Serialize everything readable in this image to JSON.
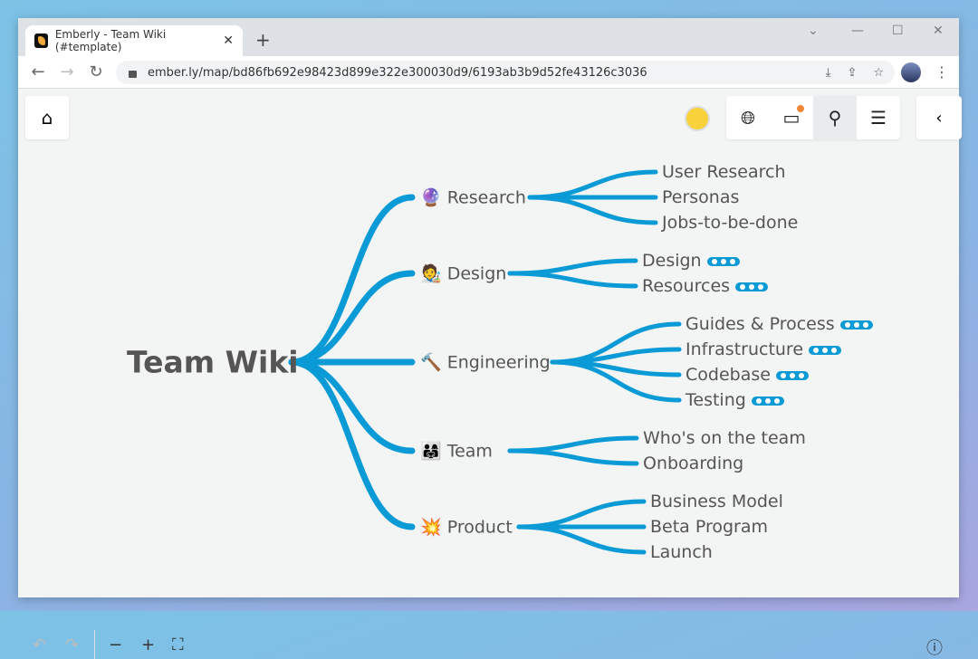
{
  "browser": {
    "tab_title": "Emberly - Team Wiki (#template)",
    "url": "ember.ly/map/bd86fb692e98423d899e322e300030d9/6193ab3b9d52fe43126c3036"
  },
  "toolbar": {
    "icons": [
      "home-icon",
      "globe-icon",
      "inbox-icon",
      "search-icon",
      "settings-sliders-icon",
      "chevron-left-icon"
    ],
    "inbox_notification": true,
    "active": "search"
  },
  "colors": {
    "branch": "#0a9ad6",
    "notification": "#f0873a"
  },
  "map": {
    "root": "Team Wiki",
    "branches": [
      {
        "label": "Research",
        "emoji": "🔮",
        "children": [
          {
            "label": "User Research",
            "more": false
          },
          {
            "label": "Personas",
            "more": false
          },
          {
            "label": "Jobs-to-be-done",
            "more": false
          }
        ]
      },
      {
        "label": "Design",
        "emoji": "🧑‍🎨",
        "children": [
          {
            "label": "Design",
            "more": true
          },
          {
            "label": "Resources",
            "more": true
          }
        ]
      },
      {
        "label": "Engineering",
        "emoji": "🔨",
        "children": [
          {
            "label": "Guides & Process",
            "more": true
          },
          {
            "label": "Infrastructure",
            "more": true
          },
          {
            "label": "Codebase",
            "more": true
          },
          {
            "label": "Testing",
            "more": true
          }
        ]
      },
      {
        "label": "Team",
        "emoji": "👨‍👩‍👧",
        "children": [
          {
            "label": "Who's on the team",
            "more": false
          },
          {
            "label": "Onboarding",
            "more": false
          }
        ]
      },
      {
        "label": "Product",
        "emoji": "💥",
        "children": [
          {
            "label": "Business Model",
            "more": false
          },
          {
            "label": "Beta Program",
            "more": false
          },
          {
            "label": "Launch",
            "more": false
          }
        ]
      }
    ]
  },
  "bottom": {
    "icons": [
      "undo-icon",
      "redo-icon",
      "zoom-out-icon",
      "zoom-in-icon",
      "fit-screen-icon",
      "help-icon"
    ]
  }
}
